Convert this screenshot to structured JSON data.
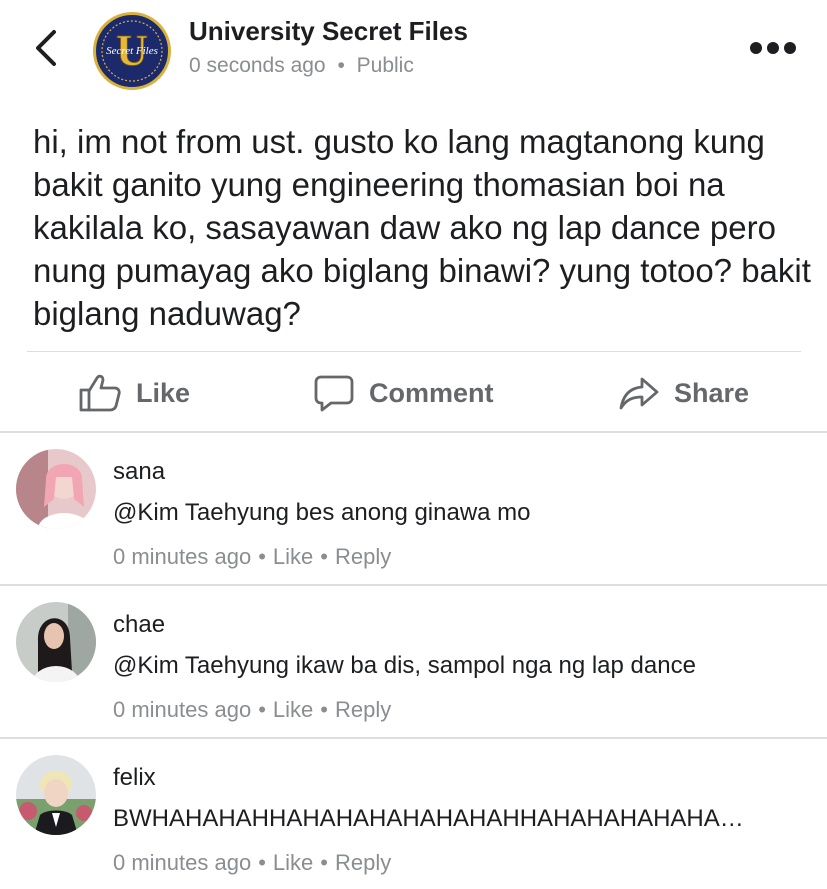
{
  "post": {
    "page_name": "University Secret Files",
    "avatar_letter": "U",
    "avatar_script": "Secret Files",
    "time": "0 seconds ago",
    "separator": "•",
    "privacy": "Public",
    "body": "hi, im not from ust. gusto ko lang magtanong kung bakit ganito yung engineering thomasian boi na kakilala ko, sasayawan daw ako ng lap dance pero nung pumayag ako biglang binawi? yung totoo? bakit biglang naduwag?"
  },
  "actions": {
    "like_label": "Like",
    "comment_label": "Comment",
    "share_label": "Share"
  },
  "comments": [
    {
      "author": "sana",
      "text": "@Kim Taehyung bes anong ginawa mo",
      "time": "0 minutes ago",
      "like": "Like",
      "reply": "Reply",
      "sep": "•"
    },
    {
      "author": "chae",
      "text": "@Kim Taehyung ikaw ba dis, sampol nga ng lap dance",
      "time": "0 minutes ago",
      "like": "Like",
      "reply": "Reply",
      "sep": "•"
    },
    {
      "author": "felix",
      "text": "BWHAHAHAHHAHAHAHAHAHAHAHHAHAHAHAHAHA…",
      "time": "0 minutes ago",
      "like": "Like",
      "reply": "Reply",
      "sep": "•"
    }
  ],
  "colors": {
    "text": "#1c1e21",
    "secondary": "#8a8d91",
    "action": "#65676b",
    "divider": "#dadde1",
    "avatar_navy": "#1c2a6b",
    "avatar_gold": "#d9b23c"
  },
  "icons": [
    "back-chevron-icon",
    "more-dots-icon",
    "like-thumb-icon",
    "comment-bubble-icon",
    "share-arrow-icon"
  ]
}
